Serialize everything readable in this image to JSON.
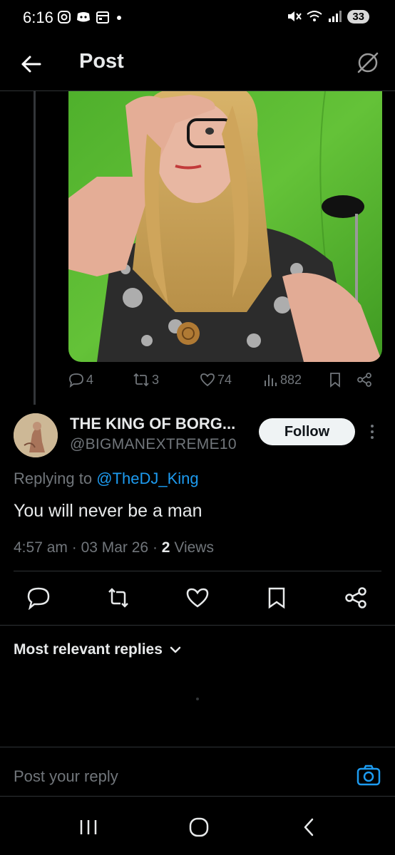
{
  "status_bar": {
    "time": "6:16",
    "battery": "33",
    "left_icons": [
      "instagram-icon",
      "discord-icon",
      "calendar-icon",
      "dot-icon"
    ],
    "right_icons": [
      "mute-icon",
      "wifi-icon",
      "signal-icon"
    ]
  },
  "header": {
    "title": "Post"
  },
  "post": {
    "image": "photo of person with long blonde hair and glasses covering face with hand against green screen",
    "stats": {
      "replies": "4",
      "reposts": "3",
      "likes": "74",
      "views": "882"
    }
  },
  "reply": {
    "display_name": "THE KING OF BORG...",
    "handle": "@BIGMANEXTREME10",
    "follow_label": "Follow",
    "replying_prefix": "Replying to",
    "replying_to": "@TheDJ_King",
    "text": "You will never be a man",
    "time": "4:57 am",
    "date": "03 Mar 26",
    "views_count": "2",
    "views_label": "Views"
  },
  "sort": {
    "label": "Most relevant replies"
  },
  "composer": {
    "placeholder": "Post your reply"
  },
  "colors": {
    "background": "#000000",
    "accent": "#1d9bf0",
    "secondary_text": "#71767b",
    "primary_text": "#e7e9ea",
    "border": "#2f3336"
  }
}
